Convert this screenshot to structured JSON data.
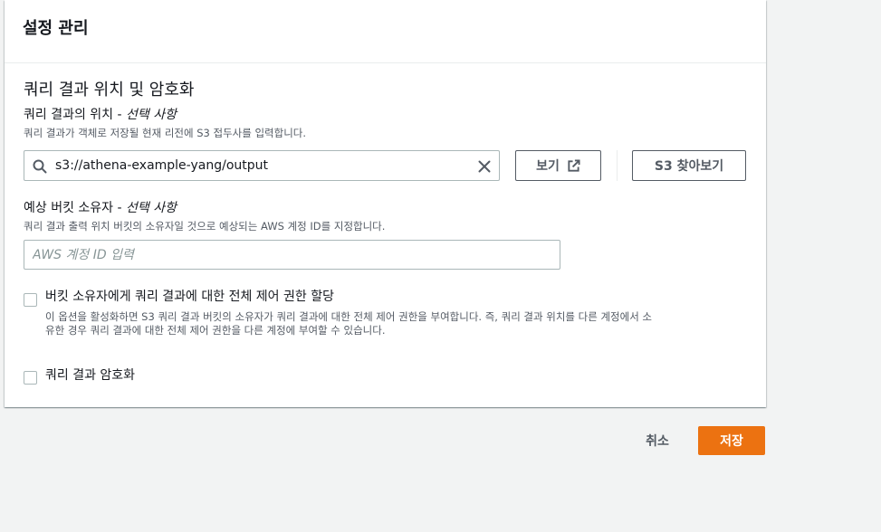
{
  "panel": {
    "title": "설정 관리"
  },
  "section": {
    "title": "쿼리 결과 위치 및 암호화"
  },
  "location": {
    "label": "쿼리 결과의 위치 -",
    "optional": "선택 사항",
    "description": "쿼리 결과가 객체로 저장될 현재 리전에 S3 접두사를 입력합니다.",
    "value": "s3://athena-example-yang/output",
    "view_button": "보기",
    "browse_button": "S3 찾아보기"
  },
  "owner": {
    "label": "예상 버킷 소유자 -",
    "optional": "선택 사항",
    "description": "쿼리 결과 출력 위치 버킷의 소유자일 것으로 예상되는 AWS 계정 ID를 지정합니다.",
    "placeholder": "AWS 계정 ID 입력",
    "value": ""
  },
  "acl_option": {
    "label": "버킷 소유자에게 쿼리 결과에 대한 전체 제어 권한 할당",
    "description_line1": "이 옵션을 활성화하면 S3 쿼리 결과 버킷의 소유자가 쿼리 결과에 대한 전체 제어 권한을 부여합니다. 즉, 쿼리 결과 위치를 다른 계정에서 소",
    "description_line2": "유한 경우 쿼리 결과에 대한 전체 제어 권한을 다른 계정에 부여할 수 있습니다.",
    "checked": false
  },
  "encrypt_option": {
    "label": "쿼리 결과 암호화",
    "checked": false
  },
  "footer": {
    "cancel": "취소",
    "save": "저장"
  },
  "colors": {
    "primary": "#ec7211",
    "text": "#16191f",
    "secondary_text": "#545b64",
    "background": "#f2f3f3"
  },
  "icons": {
    "search": "search-icon",
    "clear": "close-icon",
    "external": "external-link-icon"
  }
}
